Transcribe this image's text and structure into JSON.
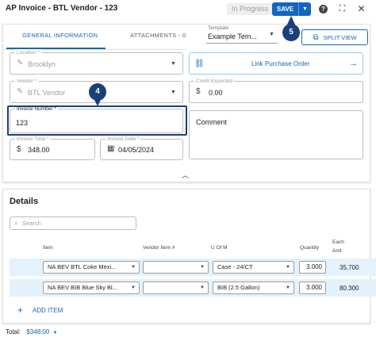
{
  "header": {
    "title": "AP Invoice - BTL Vendor - 123",
    "status": "In Progress",
    "save_label": "SAVE"
  },
  "tabs": [
    {
      "label": "GENERAL INFORMATION"
    },
    {
      "label": "ATTACHMENTS - 0"
    }
  ],
  "template": {
    "label": "Template",
    "value": "Example Tem..."
  },
  "split_view_label": "SPLIT VIEW",
  "location": {
    "label": "Location *",
    "value": "Brooklyn"
  },
  "link_po_label": "Link Purchase Order",
  "vendor": {
    "label": "Vendor *",
    "value": "BTL Vendor"
  },
  "credit_expected": {
    "label": "Credit Expected",
    "value": "0.00"
  },
  "invoice_number": {
    "label": "Invoice Number *",
    "value": "123"
  },
  "comment_label": "Comment",
  "invoice_total": {
    "label": "Invoice Total *",
    "value": "348.00"
  },
  "invoice_date": {
    "label": "Invoice Date *",
    "value": "04/05/2024"
  },
  "callouts": {
    "c4": "4",
    "c5": "5"
  },
  "details": {
    "title": "Details",
    "search_placeholder": "Search",
    "columns": {
      "item": "Item",
      "vendor_item": "Vendor Item #",
      "uom": "U Of M",
      "quantity": "Quantity",
      "each_amt_1": "Each",
      "each_amt_2": "Amt"
    },
    "rows": [
      {
        "item": "NA BEV BTL Coke Mexi...",
        "vendor_item": "",
        "uom": "Case - 24/CT",
        "quantity": "3.000",
        "each_amt": "35.700"
      },
      {
        "item": "NA BEV BIB Blue Sky Bl...",
        "vendor_item": "",
        "uom": "BIB (2.5 Gallon)",
        "quantity": "3.000",
        "each_amt": "80.300"
      }
    ],
    "add_item_label": "ADD ITEM"
  },
  "footer": {
    "label": "Total:",
    "value": "$348.00"
  }
}
